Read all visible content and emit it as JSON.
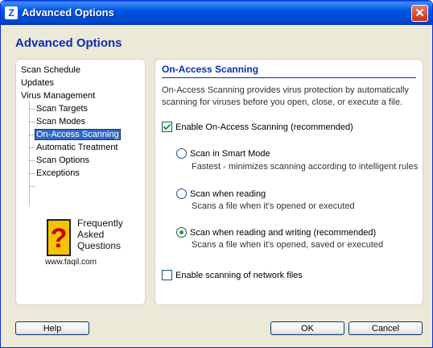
{
  "window": {
    "title": "Advanced Options",
    "close_symbol": "✕",
    "app_icon_letter": "Z"
  },
  "header": {
    "title": "Advanced Options"
  },
  "sidebar": {
    "items": [
      {
        "label": "Scan Schedule"
      },
      {
        "label": "Updates"
      },
      {
        "label": "Virus Management"
      },
      {
        "label": "Scan Targets"
      },
      {
        "label": "Scan Modes"
      },
      {
        "label": "On-Access Scanning",
        "selected": true
      },
      {
        "label": "Automatic Treatment"
      },
      {
        "label": "Scan Options"
      },
      {
        "label": "Exceptions"
      }
    ]
  },
  "faq": {
    "symbol": "?",
    "line1": "Frequently",
    "line2": "Asked",
    "line3": "Questions",
    "url": "www.faqil.com"
  },
  "main": {
    "section_title": "On-Access Scanning",
    "description": "On-Access Scanning provides virus protection by automatically scanning for viruses before you open, close, or execute a file.",
    "enable_onaccess": {
      "label": "Enable On-Access Scanning (recommended)",
      "checked": true
    },
    "options": [
      {
        "label": "Scan in Smart Mode",
        "sub": "Fastest - minimizes scanning according to intelligent rules",
        "checked": false
      },
      {
        "label": "Scan when reading",
        "sub": "Scans a file when it's opened or executed",
        "checked": false
      },
      {
        "label": "Scan when reading and writing (recommended)",
        "sub": "Scans a file when it's opened, saved or executed",
        "checked": true
      }
    ],
    "enable_network": {
      "label": "Enable scanning of network files",
      "checked": false
    }
  },
  "footer": {
    "help_label": "Help",
    "ok_label": "OK",
    "cancel_label": "Cancel"
  },
  "colors": {
    "title_bar": "#0054e3",
    "accent": "#0a2eb0",
    "selection": "#316ac5",
    "check": "#21a121"
  }
}
